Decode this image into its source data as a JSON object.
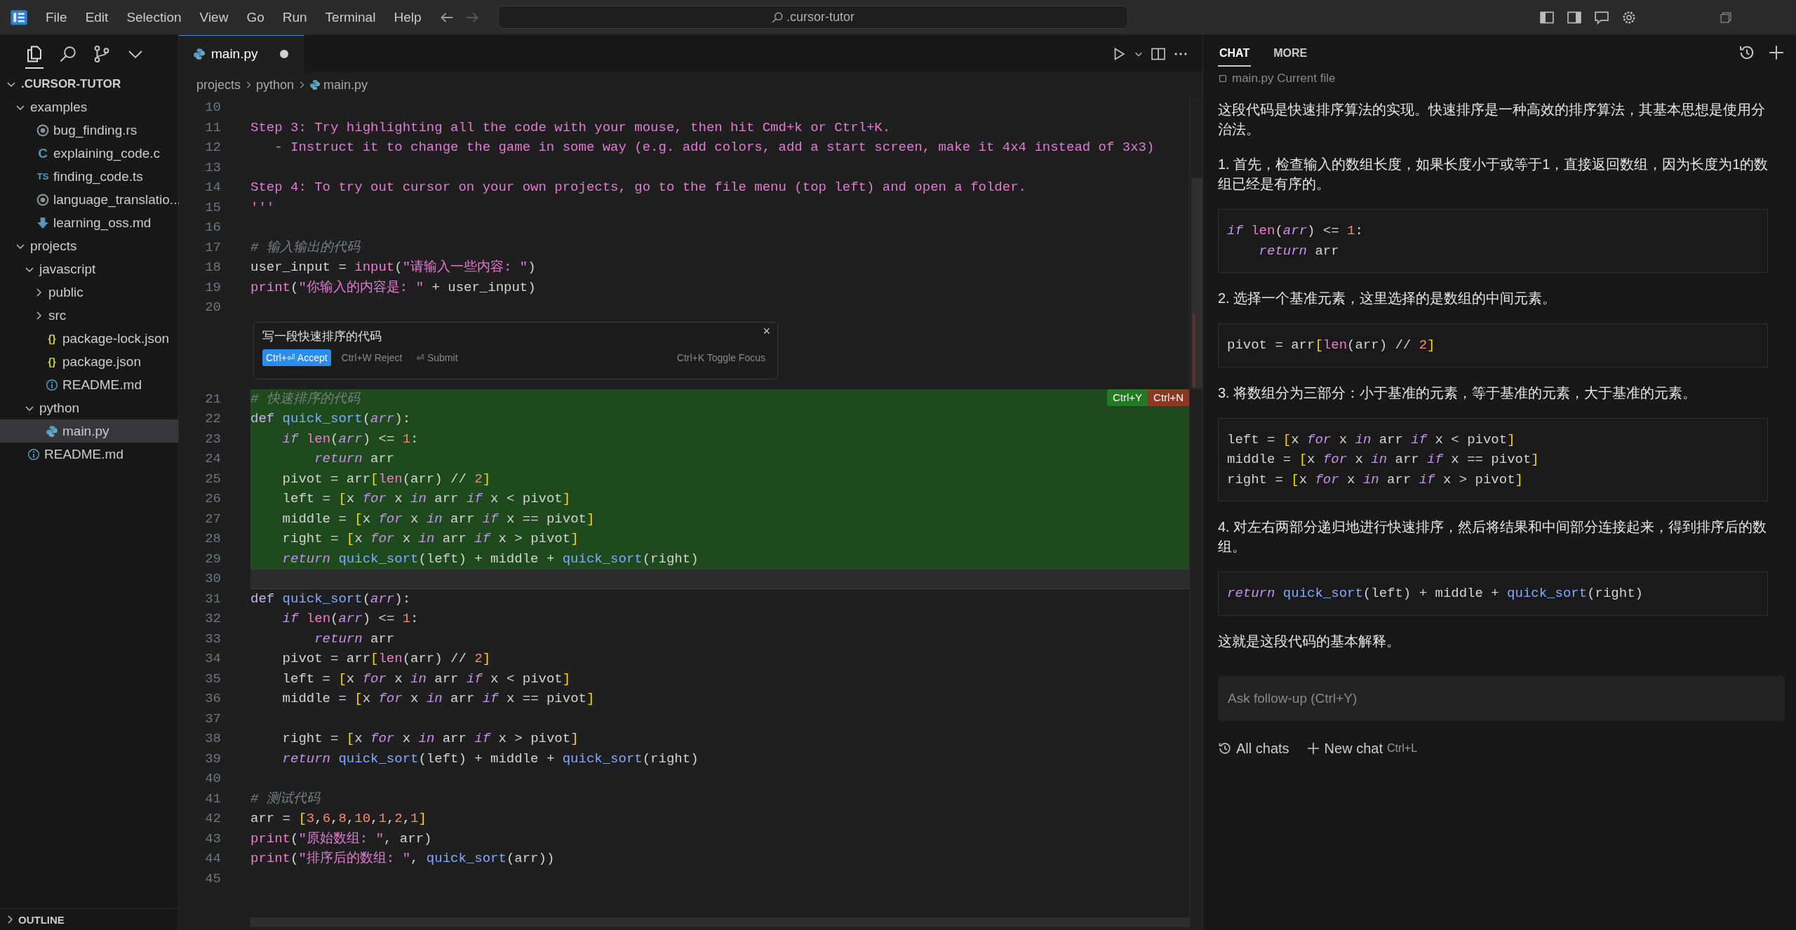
{
  "title_bar": {
    "menus": [
      "File",
      "Edit",
      "Selection",
      "View",
      "Go",
      "Run",
      "Terminal",
      "Help"
    ],
    "search": {
      "value": ".cursor-tutor"
    }
  },
  "sidebar": {
    "tree": [
      {
        "name": ".CURSOR-TUTOR",
        "kind": "root",
        "expanded": true,
        "selected": false,
        "children": [
          {
            "name": "examples",
            "kind": "folder",
            "expanded": true,
            "selected": false,
            "children": [
              {
                "name": "bug_finding.rs",
                "kind": "rust",
                "selected": false
              },
              {
                "name": "explaining_code.c",
                "kind": "c",
                "badge": "C",
                "selected": false
              },
              {
                "name": "finding_code.ts",
                "kind": "ts",
                "badge": "TS",
                "selected": false
              },
              {
                "name": "language_translatio...",
                "kind": "rust",
                "selected": false
              },
              {
                "name": "learning_oss.md",
                "kind": "markdown",
                "selected": false
              }
            ]
          },
          {
            "name": "projects",
            "kind": "folder",
            "expanded": true,
            "selected": false,
            "children": [
              {
                "name": "javascript",
                "kind": "folder",
                "expanded": true,
                "selected": false,
                "children": [
                  {
                    "name": "public",
                    "kind": "folder",
                    "expanded": false,
                    "selected": false
                  },
                  {
                    "name": "src",
                    "kind": "folder",
                    "expanded": false,
                    "selected": false
                  },
                  {
                    "name": "package-lock.json",
                    "kind": "json",
                    "badge": "{}",
                    "selected": false
                  },
                  {
                    "name": "package.json",
                    "kind": "json",
                    "badge": "{}",
                    "selected": false
                  },
                  {
                    "name": "README.md",
                    "kind": "info",
                    "selected": false
                  }
                ]
              },
              {
                "name": "python",
                "kind": "folder",
                "expanded": true,
                "selected": false,
                "children": [
                  {
                    "name": "main.py",
                    "kind": "python",
                    "selected": true
                  }
                ]
              }
            ]
          },
          {
            "name": "README.md",
            "kind": "info",
            "selected": false
          }
        ]
      }
    ],
    "outline": {
      "label": "OUTLINE",
      "expanded": false
    }
  },
  "editor": {
    "tab": {
      "label": "main.py",
      "modified": true
    },
    "breadcrumb": [
      "projects",
      "python",
      "main.py"
    ],
    "lines_before": [
      {
        "n": "10"
      },
      {
        "n": "11",
        "tokens": [
          {
            "kind": "str",
            "text": "Step 3: Try highlighting all the code with your mouse, then hit Cmd+k or Ctrl+K."
          }
        ]
      },
      {
        "n": "12",
        "tokens": [
          {
            "kind": "str",
            "text": "   - Instruct it to change the game in some way (e.g. add colors, add a start screen, make it 4x4 instead of 3x3)"
          }
        ]
      },
      {
        "n": "13"
      },
      {
        "n": "14",
        "tokens": [
          {
            "kind": "str",
            "text": "Step 4: To try out cursor on your own projects, go to the file menu (top left) and open a folder."
          }
        ]
      },
      {
        "n": "15",
        "tokens": [
          {
            "kind": "str",
            "text": "'''"
          }
        ]
      },
      {
        "n": "16"
      },
      {
        "n": "17",
        "tokens": [
          {
            "kind": "comment",
            "text": "# 输入输出的代码"
          }
        ]
      },
      {
        "n": "18",
        "tokens": [
          {
            "kind": "plain",
            "text": "user_input = "
          },
          {
            "kind": "builtin",
            "text": "input"
          },
          {
            "kind": "plain",
            "text": "("
          },
          {
            "kind": "str",
            "text": "\"请输入一些内容: \""
          },
          {
            "kind": "plain",
            "text": ")"
          }
        ]
      },
      {
        "n": "19",
        "tokens": [
          {
            "kind": "builtin",
            "text": "print"
          },
          {
            "kind": "plain",
            "text": "("
          },
          {
            "kind": "str",
            "text": "\"你输入的内容是: \""
          },
          {
            "kind": "plain",
            "text": " + user_input)"
          }
        ]
      },
      {
        "n": "20"
      }
    ],
    "inline_prompt": {
      "value": "写一段快速排序的代码",
      "accept": "Ctrl+⏎ Accept",
      "reject": "Ctrl+W Reject",
      "submit": "⏎ Submit",
      "toggle": "Ctrl+K Toggle Focus",
      "close": "×"
    },
    "diff_badges": {
      "accept": "Ctrl+Y",
      "reject": "Ctrl+N"
    },
    "lines_after": [
      {
        "n": "21",
        "added": true,
        "current": false,
        "tokens": [
          {
            "kind": "comment",
            "text": "# 快速排序的代码"
          }
        ]
      },
      {
        "n": "22",
        "added": true,
        "current": false,
        "tokens": [
          {
            "kind": "storage",
            "text": "def "
          },
          {
            "kind": "fn",
            "text": "quick_sort"
          },
          {
            "kind": "plain",
            "text": "("
          },
          {
            "kind": "param",
            "text": "arr"
          },
          {
            "kind": "plain",
            "text": "):"
          }
        ]
      },
      {
        "n": "23",
        "added": true,
        "current": false,
        "tokens": [
          {
            "kind": "kw",
            "text": "    if "
          },
          {
            "kind": "builtin",
            "text": "len"
          },
          {
            "kind": "plain",
            "text": "("
          },
          {
            "kind": "param",
            "text": "arr"
          },
          {
            "kind": "plain",
            "text": ") <= "
          },
          {
            "kind": "num",
            "text": "1"
          },
          {
            "kind": "plain",
            "text": ":"
          }
        ]
      },
      {
        "n": "24",
        "added": true,
        "current": false,
        "tokens": [
          {
            "kind": "kw",
            "text": "        return"
          },
          {
            "kind": "plain",
            "text": " arr"
          }
        ]
      },
      {
        "n": "25",
        "added": true,
        "current": false,
        "tokens": [
          {
            "kind": "plain",
            "text": "    pivot = arr"
          },
          {
            "kind": "bracket",
            "text": "["
          },
          {
            "kind": "builtin",
            "text": "len"
          },
          {
            "kind": "plain",
            "text": "(arr) // "
          },
          {
            "kind": "num",
            "text": "2"
          },
          {
            "kind": "bracket",
            "text": "]"
          }
        ]
      },
      {
        "n": "26",
        "added": true,
        "current": false,
        "tokens": [
          {
            "kind": "plain",
            "text": "    left = "
          },
          {
            "kind": "bracket",
            "text": "["
          },
          {
            "kind": "plain",
            "text": "x "
          },
          {
            "kind": "kw",
            "text": "for"
          },
          {
            "kind": "plain",
            "text": " x "
          },
          {
            "kind": "kw",
            "text": "in"
          },
          {
            "kind": "plain",
            "text": " arr "
          },
          {
            "kind": "kw",
            "text": "if"
          },
          {
            "kind": "plain",
            "text": " x < pivot"
          },
          {
            "kind": "bracket",
            "text": "]"
          }
        ]
      },
      {
        "n": "27",
        "added": true,
        "current": false,
        "tokens": [
          {
            "kind": "plain",
            "text": "    middle = "
          },
          {
            "kind": "bracket",
            "text": "["
          },
          {
            "kind": "plain",
            "text": "x "
          },
          {
            "kind": "kw",
            "text": "for"
          },
          {
            "kind": "plain",
            "text": " x "
          },
          {
            "kind": "kw",
            "text": "in"
          },
          {
            "kind": "plain",
            "text": " arr "
          },
          {
            "kind": "kw",
            "text": "if"
          },
          {
            "kind": "plain",
            "text": " x == pivot"
          },
          {
            "kind": "bracket",
            "text": "]"
          }
        ]
      },
      {
        "n": "28",
        "added": true,
        "current": false,
        "tokens": [
          {
            "kind": "plain",
            "text": "    right = "
          },
          {
            "kind": "bracket",
            "text": "["
          },
          {
            "kind": "plain",
            "text": "x "
          },
          {
            "kind": "kw",
            "text": "for"
          },
          {
            "kind": "plain",
            "text": " x "
          },
          {
            "kind": "kw",
            "text": "in"
          },
          {
            "kind": "plain",
            "text": " arr "
          },
          {
            "kind": "kw",
            "text": "if"
          },
          {
            "kind": "plain",
            "text": " x > pivot"
          },
          {
            "kind": "bracket",
            "text": "]"
          }
        ]
      },
      {
        "n": "29",
        "added": true,
        "current": false,
        "tokens": [
          {
            "kind": "kw",
            "text": "    return "
          },
          {
            "kind": "fn",
            "text": "quick_sort"
          },
          {
            "kind": "plain",
            "text": "(left) + middle + "
          },
          {
            "kind": "fn",
            "text": "quick_sort"
          },
          {
            "kind": "plain",
            "text": "(right)"
          }
        ]
      },
      {
        "n": "30",
        "added": false,
        "current": true
      },
      {
        "n": "31",
        "added": false,
        "current": false,
        "tokens": [
          {
            "kind": "storage",
            "text": "def "
          },
          {
            "kind": "fn",
            "text": "quick_sort"
          },
          {
            "kind": "plain",
            "text": "("
          },
          {
            "kind": "param",
            "text": "arr"
          },
          {
            "kind": "plain",
            "text": "):"
          }
        ]
      },
      {
        "n": "32",
        "added": false,
        "current": false,
        "tokens": [
          {
            "kind": "kw",
            "text": "    if "
          },
          {
            "kind": "builtin",
            "text": "len"
          },
          {
            "kind": "plain",
            "text": "("
          },
          {
            "kind": "param",
            "text": "arr"
          },
          {
            "kind": "plain",
            "text": ") <= "
          },
          {
            "kind": "num",
            "text": "1"
          },
          {
            "kind": "plain",
            "text": ":"
          }
        ]
      },
      {
        "n": "33",
        "added": false,
        "current": false,
        "tokens": [
          {
            "kind": "kw",
            "text": "        return"
          },
          {
            "kind": "plain",
            "text": " arr"
          }
        ]
      },
      {
        "n": "34",
        "added": false,
        "current": false,
        "tokens": [
          {
            "kind": "plain",
            "text": "    pivot = arr"
          },
          {
            "kind": "bracket",
            "text": "["
          },
          {
            "kind": "builtin",
            "text": "len"
          },
          {
            "kind": "plain",
            "text": "(arr) // "
          },
          {
            "kind": "num",
            "text": "2"
          },
          {
            "kind": "bracket",
            "text": "]"
          }
        ]
      },
      {
        "n": "35",
        "added": false,
        "current": false,
        "tokens": [
          {
            "kind": "plain",
            "text": "    left = "
          },
          {
            "kind": "bracket",
            "text": "["
          },
          {
            "kind": "plain",
            "text": "x "
          },
          {
            "kind": "kw",
            "text": "for"
          },
          {
            "kind": "plain",
            "text": " x "
          },
          {
            "kind": "kw",
            "text": "in"
          },
          {
            "kind": "plain",
            "text": " arr "
          },
          {
            "kind": "kw",
            "text": "if"
          },
          {
            "kind": "plain",
            "text": " x < pivot"
          },
          {
            "kind": "bracket",
            "text": "]"
          }
        ]
      },
      {
        "n": "36",
        "added": false,
        "current": false,
        "tokens": [
          {
            "kind": "plain",
            "text": "    middle = "
          },
          {
            "kind": "bracket",
            "text": "["
          },
          {
            "kind": "plain",
            "text": "x "
          },
          {
            "kind": "kw",
            "text": "for"
          },
          {
            "kind": "plain",
            "text": " x "
          },
          {
            "kind": "kw",
            "text": "in"
          },
          {
            "kind": "plain",
            "text": " arr "
          },
          {
            "kind": "kw",
            "text": "if"
          },
          {
            "kind": "plain",
            "text": " x == pivot"
          },
          {
            "kind": "bracket",
            "text": "]"
          }
        ]
      },
      {
        "n": "37",
        "added": false,
        "current": false
      },
      {
        "n": "38",
        "added": false,
        "current": false,
        "tokens": [
          {
            "kind": "plain",
            "text": "    right = "
          },
          {
            "kind": "bracket",
            "text": "["
          },
          {
            "kind": "plain",
            "text": "x "
          },
          {
            "kind": "kw",
            "text": "for"
          },
          {
            "kind": "plain",
            "text": " x "
          },
          {
            "kind": "kw",
            "text": "in"
          },
          {
            "kind": "plain",
            "text": " arr "
          },
          {
            "kind": "kw",
            "text": "if"
          },
          {
            "kind": "plain",
            "text": " x > pivot"
          },
          {
            "kind": "bracket",
            "text": "]"
          }
        ]
      },
      {
        "n": "39",
        "added": false,
        "current": false,
        "tokens": [
          {
            "kind": "kw",
            "text": "    return "
          },
          {
            "kind": "fn",
            "text": "quick_sort"
          },
          {
            "kind": "plain",
            "text": "(left) + middle + "
          },
          {
            "kind": "fn",
            "text": "quick_sort"
          },
          {
            "kind": "plain",
            "text": "(right)"
          }
        ]
      },
      {
        "n": "40",
        "added": false,
        "current": false
      },
      {
        "n": "41",
        "added": false,
        "current": false,
        "tokens": [
          {
            "kind": "comment",
            "text": "# 测试代码"
          }
        ]
      },
      {
        "n": "42",
        "added": false,
        "current": false,
        "tokens": [
          {
            "kind": "plain",
            "text": "arr = "
          },
          {
            "kind": "bracket",
            "text": "["
          },
          {
            "kind": "num",
            "text": "3"
          },
          {
            "kind": "plain",
            "text": ","
          },
          {
            "kind": "num",
            "text": "6"
          },
          {
            "kind": "plain",
            "text": ","
          },
          {
            "kind": "num",
            "text": "8"
          },
          {
            "kind": "plain",
            "text": ","
          },
          {
            "kind": "num",
            "text": "10"
          },
          {
            "kind": "plain",
            "text": ","
          },
          {
            "kind": "num",
            "text": "1"
          },
          {
            "kind": "plain",
            "text": ","
          },
          {
            "kind": "num",
            "text": "2"
          },
          {
            "kind": "plain",
            "text": ","
          },
          {
            "kind": "num",
            "text": "1"
          },
          {
            "kind": "bracket",
            "text": "]"
          }
        ]
      },
      {
        "n": "43",
        "added": false,
        "current": false,
        "tokens": [
          {
            "kind": "builtin",
            "text": "print"
          },
          {
            "kind": "plain",
            "text": "("
          },
          {
            "kind": "str",
            "text": "\"原始数组: \""
          },
          {
            "kind": "plain",
            "text": ", arr)"
          }
        ]
      },
      {
        "n": "44",
        "added": false,
        "current": false,
        "tokens": [
          {
            "kind": "builtin",
            "text": "print"
          },
          {
            "kind": "plain",
            "text": "("
          },
          {
            "kind": "str",
            "text": "\"排序后的数组: \""
          },
          {
            "kind": "plain",
            "text": ", "
          },
          {
            "kind": "fn",
            "text": "quick_sort"
          },
          {
            "kind": "plain",
            "text": "(arr))"
          }
        ]
      },
      {
        "n": "45",
        "added": false,
        "current": false
      }
    ]
  },
  "chat": {
    "tabs": [
      {
        "label": "CHAT",
        "selected": true
      },
      {
        "label": "MORE",
        "selected": false
      }
    ],
    "context": "main.py Current file",
    "blocks": [
      {
        "kind": "text",
        "text": "这段代码是快速排序算法的实现。快速排序是一种高效的排序算法，其基本思想是使用分治法。"
      },
      {
        "kind": "text",
        "text": "1. 首先，检查输入的数组长度，如果长度小于或等于1，直接返回数组，因为长度为1的数组已经是有序的。"
      },
      {
        "kind": "code",
        "lines": [
          [
            {
              "kind": "kw",
              "text": "if "
            },
            {
              "kind": "builtin",
              "text": "len"
            },
            {
              "kind": "plain",
              "text": "("
            },
            {
              "kind": "param",
              "text": "arr"
            },
            {
              "kind": "plain",
              "text": ") <= "
            },
            {
              "kind": "num",
              "text": "1"
            },
            {
              "kind": "plain",
              "text": ":"
            }
          ],
          [
            {
              "kind": "kw",
              "text": "    return"
            },
            {
              "kind": "plain",
              "text": " arr"
            }
          ]
        ]
      },
      {
        "kind": "text",
        "text": "2. 选择一个基准元素，这里选择的是数组的中间元素。"
      },
      {
        "kind": "code",
        "lines": [
          [
            {
              "kind": "plain",
              "text": "pivot = arr"
            },
            {
              "kind": "bracket",
              "text": "["
            },
            {
              "kind": "builtin",
              "text": "len"
            },
            {
              "kind": "plain",
              "text": "(arr) // "
            },
            {
              "kind": "num",
              "text": "2"
            },
            {
              "kind": "bracket",
              "text": "]"
            }
          ]
        ]
      },
      {
        "kind": "text",
        "text": "3. 将数组分为三部分：小于基准的元素，等于基准的元素，大于基准的元素。"
      },
      {
        "kind": "code",
        "lines": [
          [
            {
              "kind": "plain",
              "text": "left = "
            },
            {
              "kind": "bracket",
              "text": "["
            },
            {
              "kind": "plain",
              "text": "x "
            },
            {
              "kind": "kw",
              "text": "for"
            },
            {
              "kind": "plain",
              "text": " x "
            },
            {
              "kind": "kw",
              "text": "in"
            },
            {
              "kind": "plain",
              "text": " arr "
            },
            {
              "kind": "kw",
              "text": "if"
            },
            {
              "kind": "plain",
              "text": " x < pivot"
            },
            {
              "kind": "bracket",
              "text": "]"
            }
          ],
          [
            {
              "kind": "plain",
              "text": "middle = "
            },
            {
              "kind": "bracket",
              "text": "["
            },
            {
              "kind": "plain",
              "text": "x "
            },
            {
              "kind": "kw",
              "text": "for"
            },
            {
              "kind": "plain",
              "text": " x "
            },
            {
              "kind": "kw",
              "text": "in"
            },
            {
              "kind": "plain",
              "text": " arr "
            },
            {
              "kind": "kw",
              "text": "if"
            },
            {
              "kind": "plain",
              "text": " x == pivot"
            },
            {
              "kind": "bracket",
              "text": "]"
            }
          ],
          [
            {
              "kind": "plain",
              "text": "right = "
            },
            {
              "kind": "bracket",
              "text": "["
            },
            {
              "kind": "plain",
              "text": "x "
            },
            {
              "kind": "kw",
              "text": "for"
            },
            {
              "kind": "plain",
              "text": " x "
            },
            {
              "kind": "kw",
              "text": "in"
            },
            {
              "kind": "plain",
              "text": " arr "
            },
            {
              "kind": "kw",
              "text": "if"
            },
            {
              "kind": "plain",
              "text": " x > pivot"
            },
            {
              "kind": "bracket",
              "text": "]"
            }
          ]
        ]
      },
      {
        "kind": "text",
        "text": "4. 对左右两部分递归地进行快速排序，然后将结果和中间部分连接起来，得到排序后的数组。"
      },
      {
        "kind": "code",
        "lines": [
          [
            {
              "kind": "kw",
              "text": "return "
            },
            {
              "kind": "fn",
              "text": "quick_sort"
            },
            {
              "kind": "plain",
              "text": "(left) + middle + "
            },
            {
              "kind": "fn",
              "text": "quick_sort"
            },
            {
              "kind": "plain",
              "text": "(right)"
            }
          ]
        ]
      },
      {
        "kind": "text",
        "text": "这就是这段代码的基本解释。"
      }
    ],
    "input": {
      "placeholder": "Ask follow-up (Ctrl+Y)"
    },
    "footer": {
      "all_chats": "All chats",
      "new_chat": "New chat",
      "new_chat_shortcut": "Ctrl+L"
    }
  }
}
